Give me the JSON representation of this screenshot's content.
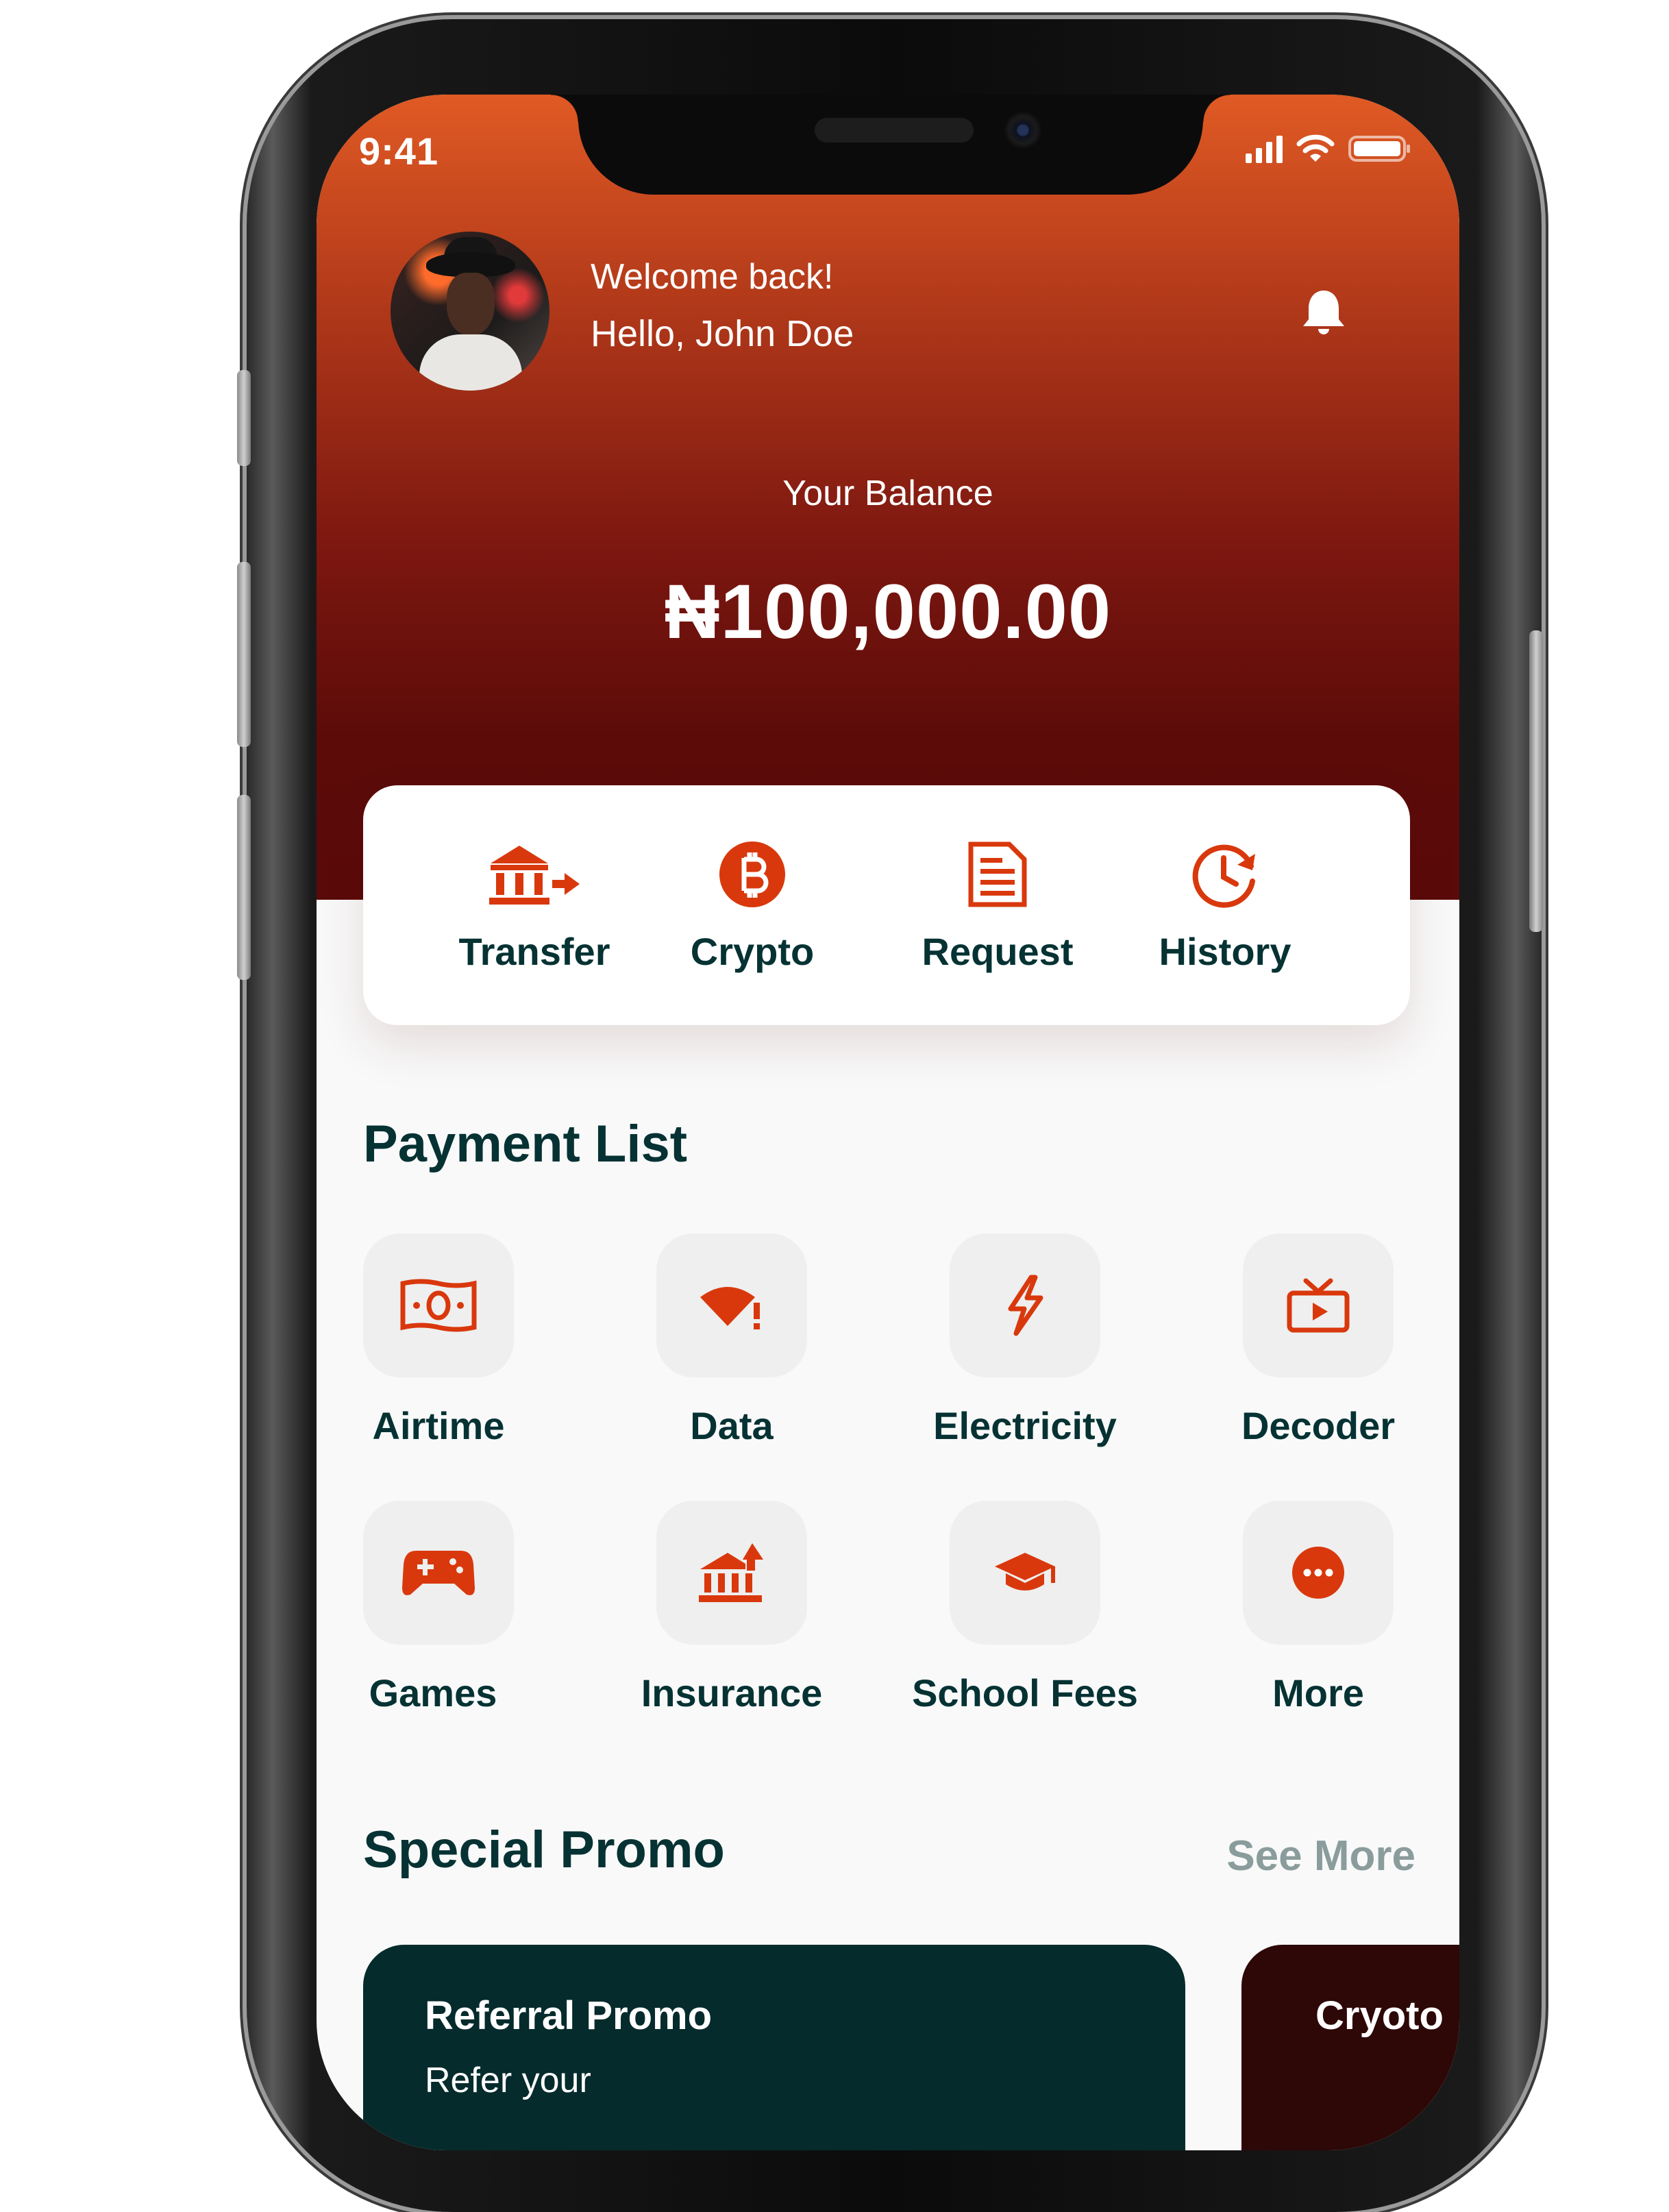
{
  "status": {
    "time": "9:41"
  },
  "user": {
    "welcome": "Welcome back!",
    "greeting": "Hello, John Doe"
  },
  "balance": {
    "label": "Your Balance",
    "value": "₦100,000.00"
  },
  "actions": [
    {
      "label": "Transfer",
      "icon": "bank-transfer-icon"
    },
    {
      "label": "Crypto",
      "icon": "bitcoin-icon"
    },
    {
      "label": "Request",
      "icon": "document-icon"
    },
    {
      "label": "History",
      "icon": "clock-history-icon"
    }
  ],
  "payment_list": {
    "title": "Payment List",
    "items": [
      {
        "label": "Airtime",
        "icon": "cash-icon"
      },
      {
        "label": "Data",
        "icon": "wifi-data-icon"
      },
      {
        "label": "Electricity",
        "icon": "lightning-icon"
      },
      {
        "label": "Decoder",
        "icon": "tv-icon"
      },
      {
        "label": "Games",
        "icon": "gamepad-icon"
      },
      {
        "label": "Insurance",
        "icon": "insurance-bank-icon"
      },
      {
        "label": "School Fees",
        "icon": "graduation-cap-icon"
      },
      {
        "label": "More",
        "icon": "more-dots-icon"
      }
    ]
  },
  "promo": {
    "title": "Special Promo",
    "see_more": "See More",
    "cards": [
      {
        "title": "Referral Promo",
        "subtitle": "Refer your"
      },
      {
        "title": "Cryoto"
      }
    ]
  },
  "colors": {
    "accent": "#d9380d",
    "heading": "#063233",
    "header_top": "#e05a24",
    "header_bottom": "#5a0a09"
  }
}
